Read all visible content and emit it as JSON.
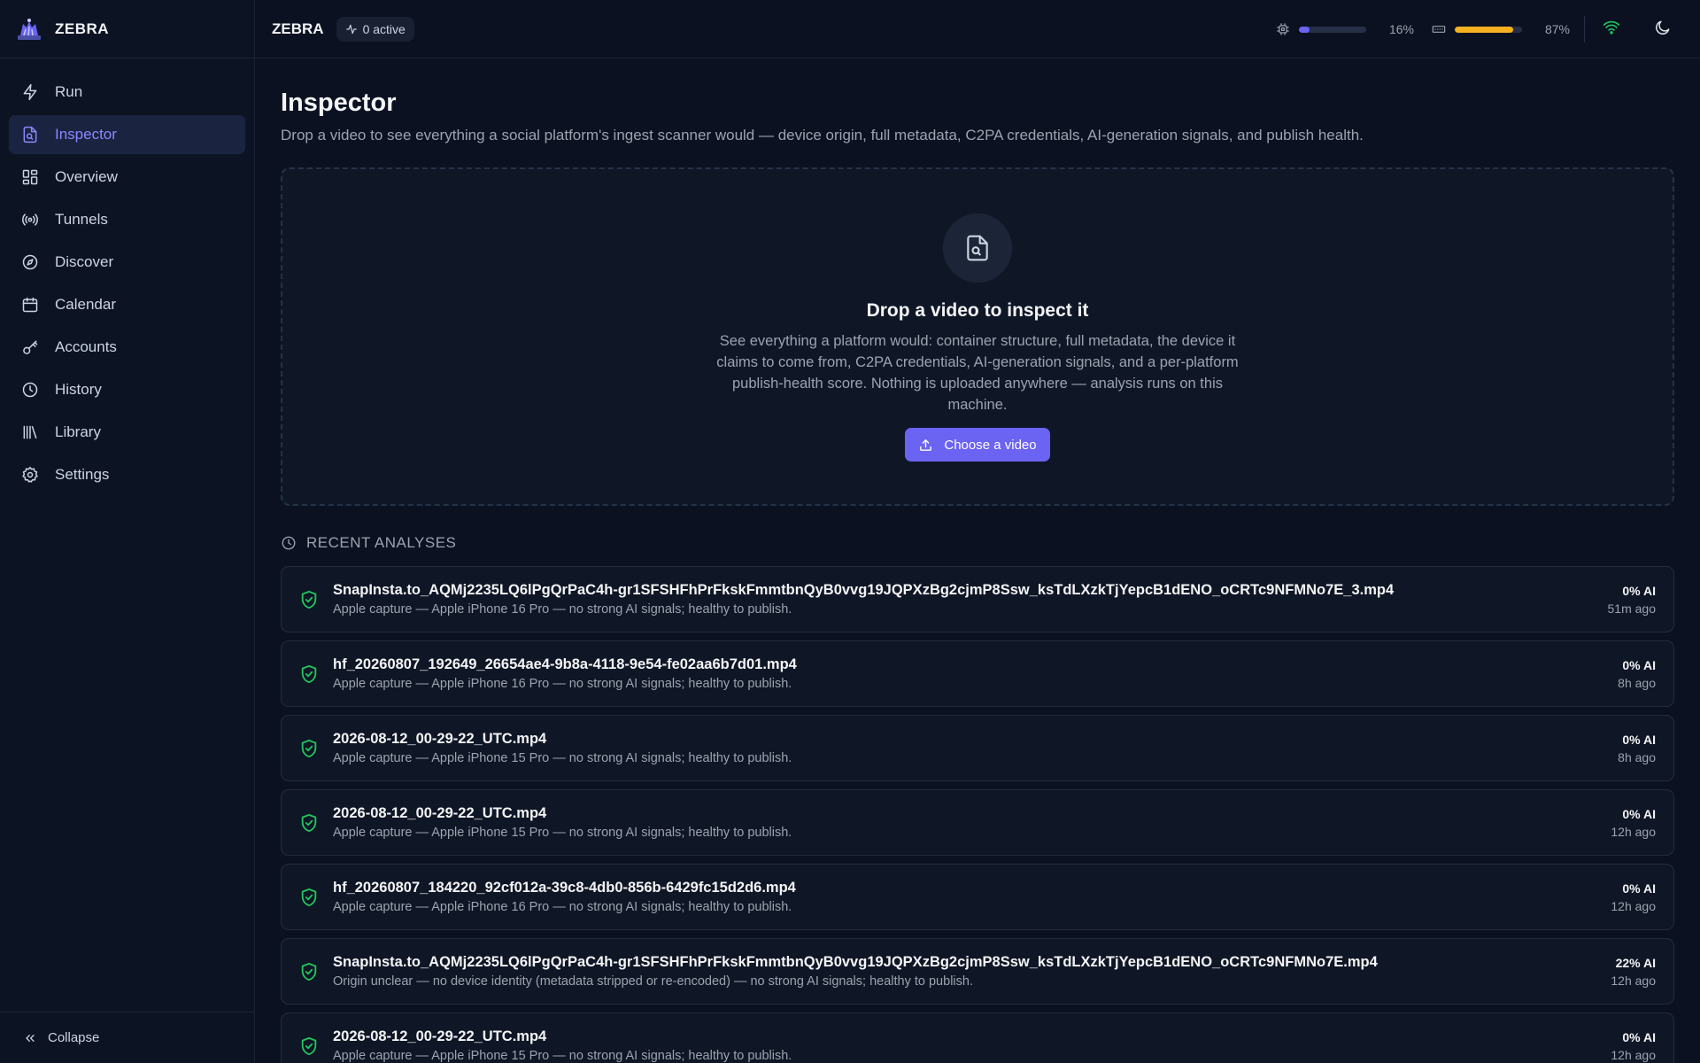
{
  "app": {
    "name": "ZEBRA"
  },
  "sidebar": {
    "items": [
      {
        "label": "Run",
        "icon": "bolt-icon",
        "active": false
      },
      {
        "label": "Inspector",
        "icon": "file-search-icon",
        "active": true
      },
      {
        "label": "Overview",
        "icon": "grid-icon",
        "active": false
      },
      {
        "label": "Tunnels",
        "icon": "radio-icon",
        "active": false
      },
      {
        "label": "Discover",
        "icon": "compass-icon",
        "active": false
      },
      {
        "label": "Calendar",
        "icon": "calendar-icon",
        "active": false
      },
      {
        "label": "Accounts",
        "icon": "key-icon",
        "active": false
      },
      {
        "label": "History",
        "icon": "clock-icon",
        "active": false
      },
      {
        "label": "Library",
        "icon": "library-icon",
        "active": false
      },
      {
        "label": "Settings",
        "icon": "gear-icon",
        "active": false
      }
    ],
    "collapse_label": "Collapse"
  },
  "topbar": {
    "title": "ZEBRA",
    "active_label": "0 active",
    "cpu": {
      "value": 16,
      "label": "16%",
      "color": "#6b63f2",
      "icon": "cpu-icon"
    },
    "memory": {
      "value": 87,
      "label": "87%",
      "color": "#f5b11f",
      "icon": "memory-icon"
    },
    "wifi_color": "#22c55e"
  },
  "page": {
    "title": "Inspector",
    "subtitle": "Drop a video to see everything a social platform's ingest scanner would — device origin, full metadata, C2PA credentials, AI-generation signals, and publish health."
  },
  "dropzone": {
    "title": "Drop a video to inspect it",
    "text": "See everything a platform would: container structure, full metadata, the device it claims to come from, C2PA credentials, AI-generation signals, and a per-platform publish-health score. Nothing is uploaded anywhere — analysis runs on this machine.",
    "button_label": "Choose a video"
  },
  "recent": {
    "heading": "RECENT ANALYSES",
    "items": [
      {
        "name": "SnapInsta.to_AQMj2235LQ6lPgQrPaC4h-gr1SFSHFhPrFkskFmmtbnQyB0vvg19JQPXzBg2cjmP8Ssw_ksTdLXzkTjYepcB1dENO_oCRTc9NFMNo7E_3.mp4",
        "desc": "Apple capture — Apple iPhone 16 Pro — no strong AI signals; healthy to publish.",
        "ai": "0% AI",
        "time": "51m ago"
      },
      {
        "name": "hf_20260807_192649_26654ae4-9b8a-4118-9e54-fe02aa6b7d01.mp4",
        "desc": "Apple capture — Apple iPhone 16 Pro — no strong AI signals; healthy to publish.",
        "ai": "0% AI",
        "time": "8h ago"
      },
      {
        "name": "2026-08-12_00-29-22_UTC.mp4",
        "desc": "Apple capture — Apple iPhone 15 Pro — no strong AI signals; healthy to publish.",
        "ai": "0% AI",
        "time": "8h ago"
      },
      {
        "name": "2026-08-12_00-29-22_UTC.mp4",
        "desc": "Apple capture — Apple iPhone 15 Pro — no strong AI signals; healthy to publish.",
        "ai": "0% AI",
        "time": "12h ago"
      },
      {
        "name": "hf_20260807_184220_92cf012a-39c8-4db0-856b-6429fc15d2d6.mp4",
        "desc": "Apple capture — Apple iPhone 16 Pro — no strong AI signals; healthy to publish.",
        "ai": "0% AI",
        "time": "12h ago"
      },
      {
        "name": "SnapInsta.to_AQMj2235LQ6lPgQrPaC4h-gr1SFSHFhPrFkskFmmtbnQyB0vvg19JQPXzBg2cjmP8Ssw_ksTdLXzkTjYepcB1dENO_oCRTc9NFMNo7E.mp4",
        "desc": "Origin unclear — no device identity (metadata stripped or re-encoded) — no strong AI signals; healthy to publish.",
        "ai": "22% AI",
        "time": "12h ago"
      },
      {
        "name": "2026-08-12_00-29-22_UTC.mp4",
        "desc": "Apple capture — Apple iPhone 15 Pro — no strong AI signals; healthy to publish.",
        "ai": "0% AI",
        "time": "12h ago"
      }
    ],
    "status_icon_color": "#22c55e"
  }
}
